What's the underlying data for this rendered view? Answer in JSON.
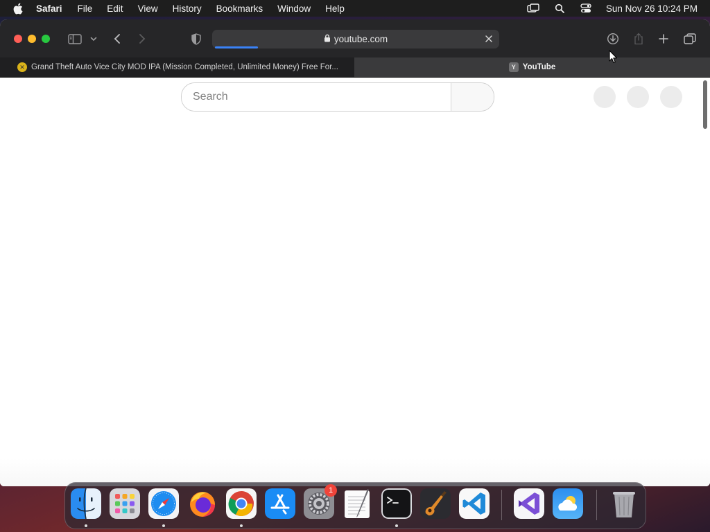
{
  "menubar": {
    "app_name": "Safari",
    "items": [
      "File",
      "Edit",
      "View",
      "History",
      "Bookmarks",
      "Window",
      "Help"
    ],
    "clock": "Sun Nov 26  10:24 PM"
  },
  "toolbar": {
    "url": "youtube.com",
    "load_progress": 0.15
  },
  "tabs": [
    {
      "title": "Grand Theft Auto Vice City MOD IPA (Mission Completed, Unlimited Money) Free For...",
      "active": false
    },
    {
      "title": "YouTube",
      "favicon_letter": "Y",
      "active": true
    }
  ],
  "page": {
    "search_placeholder": "Search"
  },
  "dock": {
    "apps": [
      "Finder",
      "Launchpad",
      "Safari",
      "Firefox",
      "Chrome",
      "App Store",
      "System Settings",
      "TextEdit",
      "Terminal",
      "GarageBand",
      "Visual Studio Code",
      "Visual Studio",
      "Weather",
      "Trash"
    ],
    "settings_badge": "1"
  },
  "colors": {
    "accent": "#3a82f7",
    "badge": "#f0443a",
    "close": "#ff5f57",
    "minimize": "#febc2e",
    "maximize": "#28c840"
  }
}
